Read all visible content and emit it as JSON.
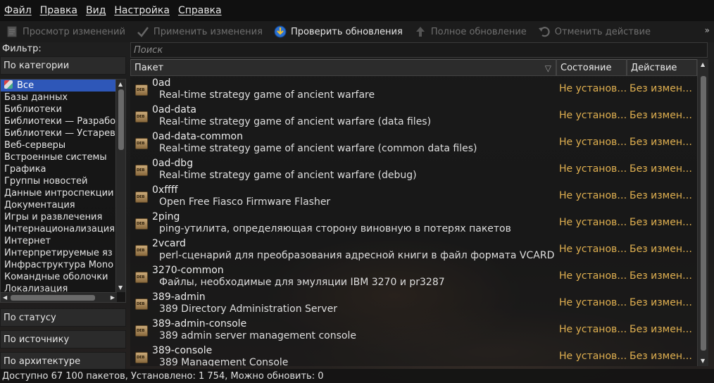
{
  "menu": [
    "Файл",
    "Правка",
    "Вид",
    "Настройка",
    "Справка"
  ],
  "toolbar": {
    "review": "Просмотр изменений",
    "apply": "Применить изменения",
    "check": "Проверить обновления",
    "full_upgrade": "Полное обновление",
    "undo": "Отменить действие",
    "more": "»"
  },
  "filter": {
    "label": "Фильтр:",
    "by_category": "По категории",
    "by_status": "По статусу",
    "by_origin": "По источнику",
    "by_arch": "По архитектуре",
    "categories": [
      "Все",
      "Базы данных",
      "Библиотеки",
      "Библиотеки — Разрабо",
      "Библиотеки — Устарев",
      "Веб-серверы",
      "Встроенные системы",
      "Графика",
      "Группы новостей",
      "Данные интроспекции",
      "Документация",
      "Игры и развлечения",
      "Интернационализация",
      "Интернет",
      "Интерпретируемые яз",
      "Инфраструктура Mono",
      "Командные оболочки",
      "Локализация"
    ]
  },
  "search": {
    "placeholder": "Поиск"
  },
  "table": {
    "columns": {
      "package": "Пакет",
      "state": "Состояние",
      "action": "Действие"
    },
    "deb_label": "DEB",
    "rows": [
      {
        "name": "0ad",
        "desc": "Real-time strategy game of ancient warfare",
        "state": "Не установлен",
        "action": "Без изменений"
      },
      {
        "name": "0ad-data",
        "desc": "Real-time strategy game of ancient warfare (data files)",
        "state": "Не установлен",
        "action": "Без изменений"
      },
      {
        "name": "0ad-data-common",
        "desc": "Real-time strategy game of ancient warfare (common data files)",
        "state": "Не установлен",
        "action": "Без изменений"
      },
      {
        "name": "0ad-dbg",
        "desc": "Real-time strategy game of ancient warfare (debug)",
        "state": "Не установлен",
        "action": "Без изменений"
      },
      {
        "name": "0xffff",
        "desc": "Open Free Fiasco Firmware Flasher",
        "state": "Не установлен",
        "action": "Без изменений"
      },
      {
        "name": "2ping",
        "desc": "ping-утилита, определяющая сторону виновную в потерях пакетов",
        "state": "Не установлен",
        "action": "Без изменений"
      },
      {
        "name": "2vcard",
        "desc": "perl-сценарий для преобразования адресной книги в файл формата VCARD",
        "state": "Не установлен",
        "action": "Без изменений"
      },
      {
        "name": "3270-common",
        "desc": "Файлы, необходимые для эмуляции IBM 3270 и pr3287",
        "state": "Не установлен",
        "action": "Без изменений"
      },
      {
        "name": "389-admin",
        "desc": "389 Directory Administration Server",
        "state": "Не установлен",
        "action": "Без изменений"
      },
      {
        "name": "389-admin-console",
        "desc": "389 admin server management console",
        "state": "Не установлен",
        "action": "Без изменений"
      },
      {
        "name": "389-console",
        "desc": "389 Management Console",
        "state": "Не установлен",
        "action": "Без изменений"
      }
    ]
  },
  "status": "Доступно 67 100 пакетов, Установлено: 1 754, Можно обновить: 0",
  "colors": {
    "selection": "#2e57b8",
    "state_text": "#e0b050"
  }
}
